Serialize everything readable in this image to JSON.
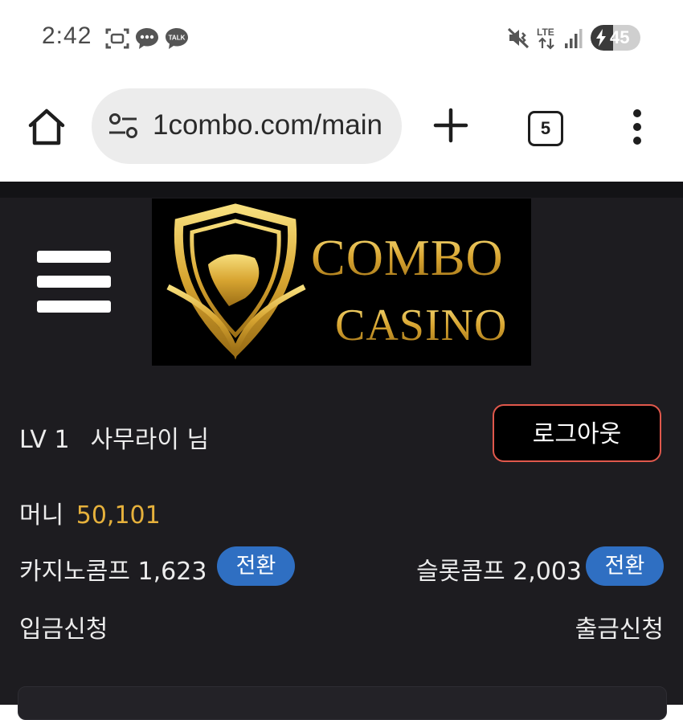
{
  "status_bar": {
    "time": "2:42",
    "icons": [
      "screenshot-icon",
      "chat-bubble-icon",
      "kakaotalk-icon",
      "mute-vibrate-icon",
      "lte-icon",
      "signal-icon"
    ],
    "battery_percent": "45",
    "battery_level": 0.45
  },
  "browser": {
    "url": "1combo.com/main",
    "tab_count": "5",
    "icons": [
      "home-icon",
      "site-settings-icon",
      "plus-icon",
      "more-vert-icon"
    ]
  },
  "site": {
    "logo_alt": "COMBO CASINO",
    "user": {
      "level": "LV 1",
      "name": "사무라이 님"
    },
    "logout_label": "로그아웃",
    "money": {
      "label": "머니",
      "value": "50,101"
    },
    "casino_comp": {
      "label": "카지노콤프",
      "value": "1,623",
      "convert_label": "전환"
    },
    "slot_comp": {
      "label": "슬롯콤프",
      "value": "2,003",
      "convert_label": "전환"
    },
    "deposit_label": "입금신청",
    "withdraw_label": "출금신청"
  },
  "colors": {
    "background": "#1d1c20",
    "gold": "#e6b13c",
    "pill_blue": "#2f6fc2",
    "logout_border": "#e0584c"
  }
}
